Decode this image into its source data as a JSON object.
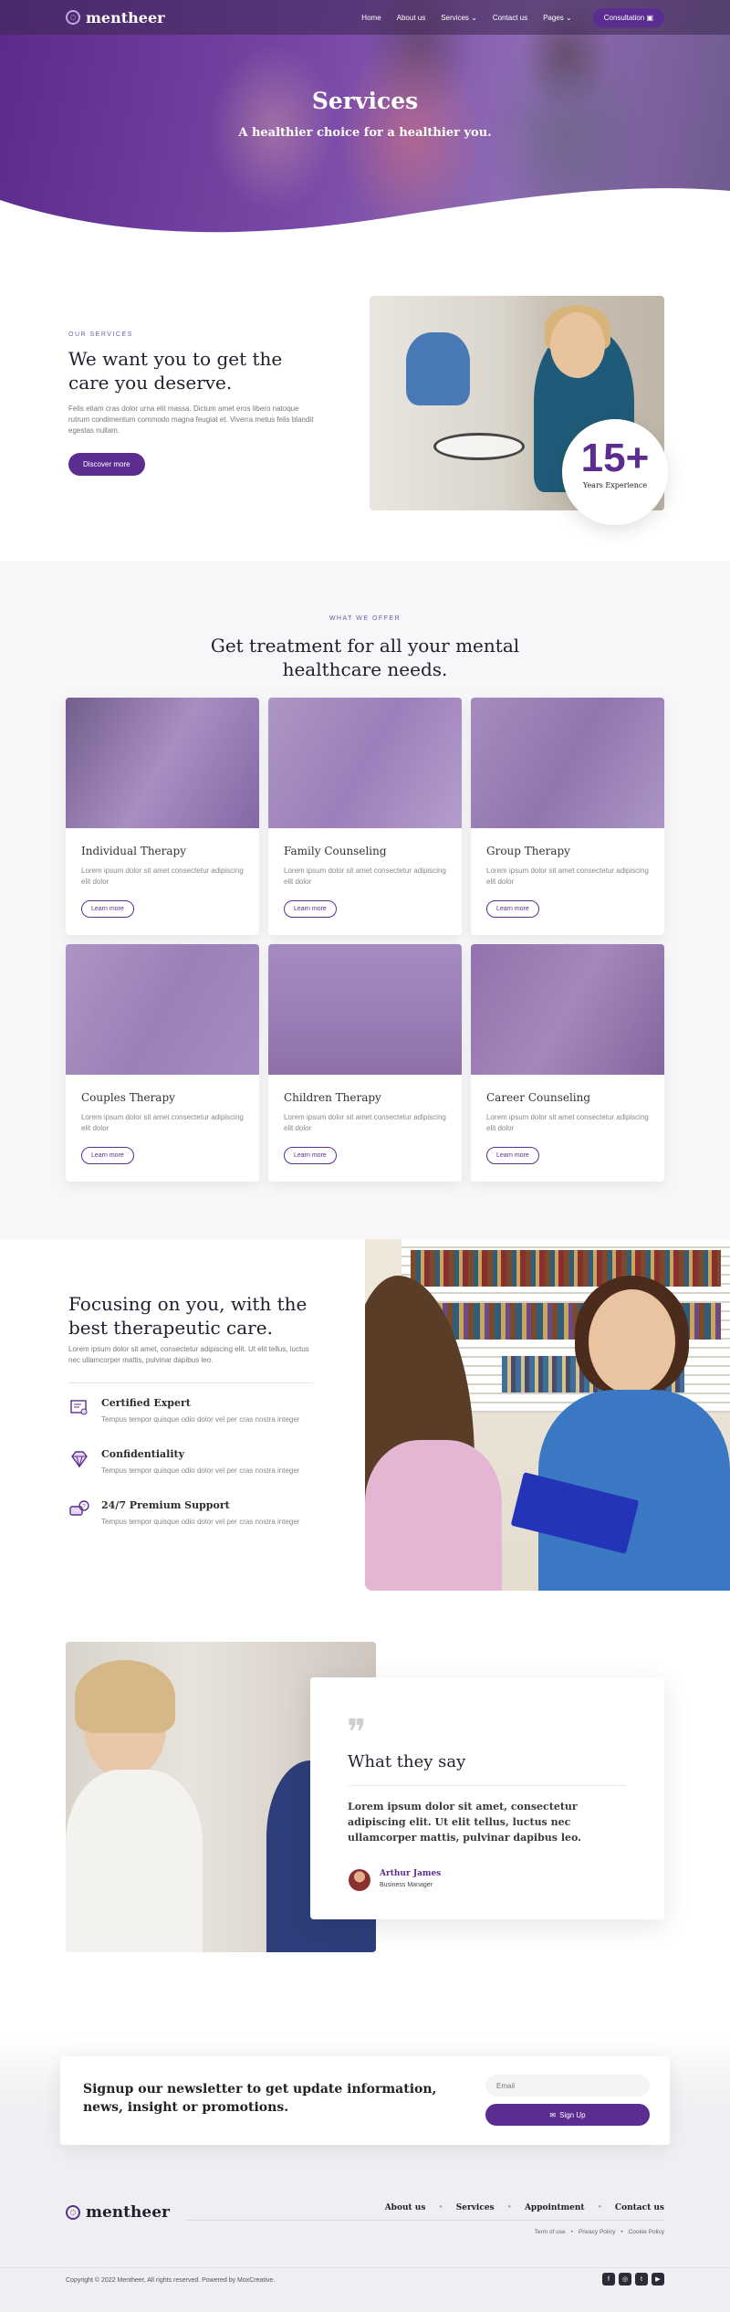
{
  "nav": {
    "brand": "mentheer",
    "links": [
      "Home",
      "About us",
      "Services",
      "Contact us",
      "Pages"
    ],
    "cta": "Consultation"
  },
  "hero": {
    "title": "Services",
    "subtitle": "A healthier choice for a healthier you."
  },
  "our_services": {
    "eyebrow": "OUR SERVICES",
    "title": "We want you to get the care you deserve.",
    "body": "Felis etiam cras dolor urna elit massa. Dictum amet eros libero natoque rutrum condimentum commodo magna feugiat et. Viverra metus felis blandit egestas nullam.",
    "button": "Discover more",
    "badge_number": "15+",
    "badge_label": "Years Experience"
  },
  "offer": {
    "eyebrow": "WHAT WE OFFER",
    "title": "Get treatment for all your mental healthcare needs.",
    "cards": [
      {
        "title": "Individual Therapy",
        "body": "Lorem ipsum dolor sit amet consectetur adipiscing elit dolor",
        "button": "Learn more"
      },
      {
        "title": "Family Counseling",
        "body": "Lorem ipsum dolor sit amet consectetur adipiscing elit dolor",
        "button": "Learn more"
      },
      {
        "title": "Group Therapy",
        "body": "Lorem ipsum dolor sit amet consectetur adipiscing elit dolor",
        "button": "Learn more"
      },
      {
        "title": "Couples Therapy",
        "body": "Lorem ipsum dolor sit amet consectetur adipiscing elit dolor",
        "button": "Learn more"
      },
      {
        "title": "Children Therapy",
        "body": "Lorem ipsum dolor sit amet consectetur adipiscing elit dolor",
        "button": "Learn more"
      },
      {
        "title": "Career Counseling",
        "body": "Lorem ipsum dolor sit amet consectetur adipiscing elit dolor",
        "button": "Learn more"
      }
    ]
  },
  "focus": {
    "title": "Focusing on you, with the best therapeutic care.",
    "intro": "Lorem ipsum dolor sit amet, consectetur adipiscing elit. Ut elit tellus, luctus nec ullamcorper mattis, pulvinar dapibus leo.",
    "features": [
      {
        "icon": "certificate-icon",
        "title": "Certified Expert",
        "body": "Tempus tempor quisque odio dolor vel per cras nostra integer"
      },
      {
        "icon": "diamond-icon",
        "title": "Confidentiality",
        "body": "Tempus tempor quisque odio dolor vel per cras nostra integer"
      },
      {
        "icon": "chat-support-icon",
        "title": "24/7 Premium Support",
        "body": "Tempus tempor quisque odio dolor vel per cras nostra integer"
      }
    ]
  },
  "testimonial": {
    "title": "What they say",
    "quote": "Lorem ipsum dolor sit amet, consectetur adipiscing elit. Ut elit tellus, luctus nec ullamcorper mattis, pulvinar dapibus leo.",
    "author": "Arthur James",
    "role": "Business Manager"
  },
  "newsletter": {
    "title": "Signup our newsletter to get update information, news, insight or promotions.",
    "email_placeholder": "Email",
    "button": "Sign Up"
  },
  "footer": {
    "brand": "mentheer",
    "links": [
      "About us",
      "Services",
      "Appointment",
      "Contact us"
    ],
    "legal": [
      "Term of use",
      "Privacy Policy",
      "Cookie Policy"
    ],
    "copyright": "Copyright © 2022 Mentheer, All rights reserved. Powered by MoxCreative.",
    "social": [
      "facebook-icon",
      "instagram-icon",
      "twitter-icon",
      "youtube-icon"
    ]
  },
  "colors": {
    "brand": "#5c2d91",
    "hero_overlay": "#7a4aa8",
    "footer_bg": "#efeff3"
  }
}
